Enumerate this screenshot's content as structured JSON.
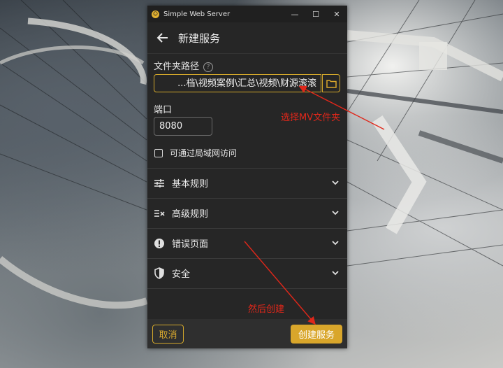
{
  "window": {
    "app_title": "Simple Web Server",
    "controls": {
      "minimize": "—",
      "maximize": "☐",
      "close": "✕"
    }
  },
  "header": {
    "title": "新建服务"
  },
  "folder": {
    "label": "文件夹路径",
    "help": "?",
    "value": "...档\\视频案例\\汇总\\视频\\财源滚滚"
  },
  "port": {
    "label": "端口",
    "value": "8080"
  },
  "lan": {
    "label": "可通过局域网访问",
    "checked": false
  },
  "sections": [
    {
      "label": "基本规则",
      "icon": "sliders-icon"
    },
    {
      "label": "高级规则",
      "icon": "advanced-rules-icon"
    },
    {
      "label": "错误页面",
      "icon": "error-icon"
    },
    {
      "label": "安全",
      "icon": "shield-icon"
    }
  ],
  "footer": {
    "cancel": "取消",
    "create": "创建服务"
  },
  "annotations": {
    "select_folder": "选择MV文件夹",
    "then_create": "然后创建"
  },
  "colors": {
    "accent": "#d9a62b",
    "annotation": "#e0271a",
    "window_bg": "#262626"
  }
}
